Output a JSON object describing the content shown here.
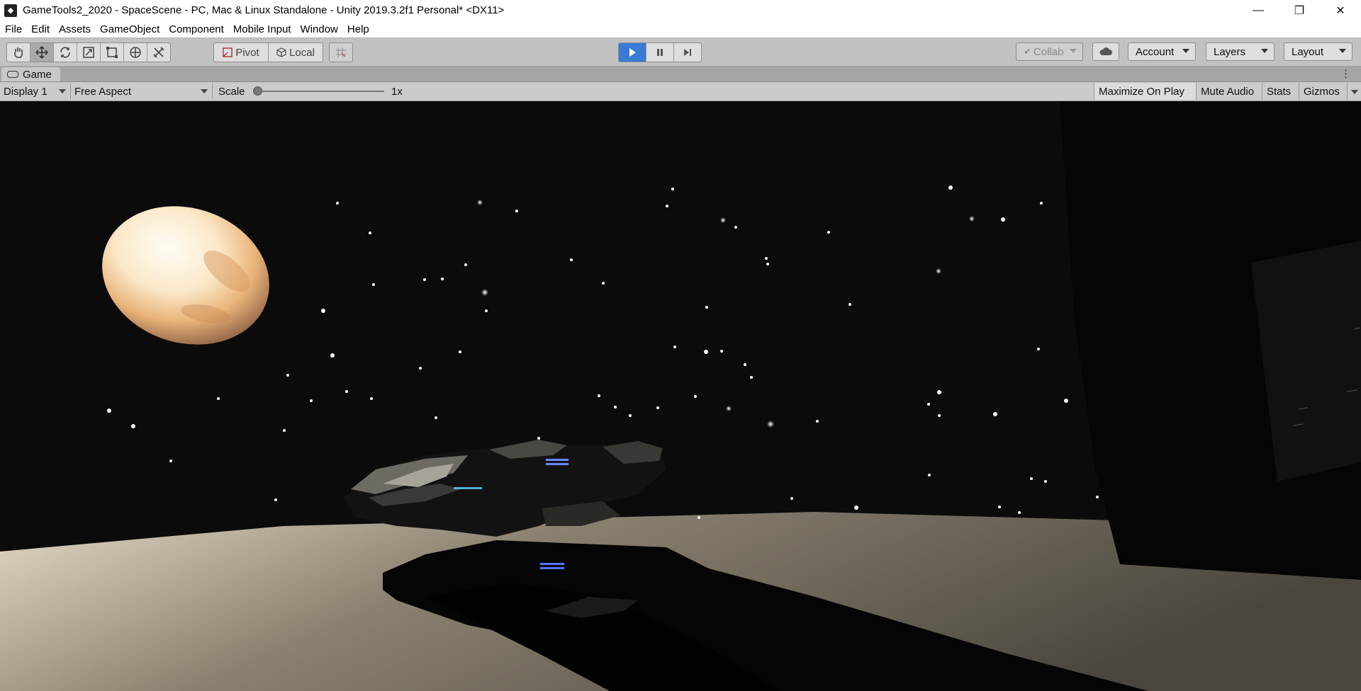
{
  "window": {
    "title": "GameTools2_2020 - SpaceScene - PC, Mac & Linux Standalone - Unity 2019.3.2f1 Personal* <DX11>",
    "controls": {
      "minimize": "—",
      "maximize": "❐",
      "close": "✕"
    }
  },
  "menu": [
    "File",
    "Edit",
    "Assets",
    "GameObject",
    "Component",
    "Mobile Input",
    "Window",
    "Help"
  ],
  "toolbar": {
    "tools": [
      "hand-tool",
      "move-tool",
      "rotate-tool",
      "scale-tool",
      "rect-tool",
      "transform-tool",
      "custom-tool"
    ],
    "active_tool": "move-tool",
    "pivot_label": "Pivot",
    "local_label": "Local",
    "play_active": true,
    "collab_label": "Collab",
    "account_label": "Account",
    "layers_label": "Layers",
    "layout_label": "Layout"
  },
  "tab": {
    "label": "Game"
  },
  "game_controls": {
    "display": "Display 1",
    "aspect": "Free Aspect",
    "scale_label": "Scale",
    "scale_value": "1x",
    "maximize_on_play": "Maximize On Play",
    "mute_audio": "Mute Audio",
    "stats": "Stats",
    "gizmos": "Gizmos"
  },
  "scene": {
    "colors": {
      "sky": "#0b0b0b",
      "planet_light": "#fff8e8",
      "planet_warm": "#e2a467",
      "floor_light": "#d8d0b8",
      "floor_dark": "#4a463d",
      "wall": "#050505",
      "engine_glow": "#4d6dff"
    }
  }
}
